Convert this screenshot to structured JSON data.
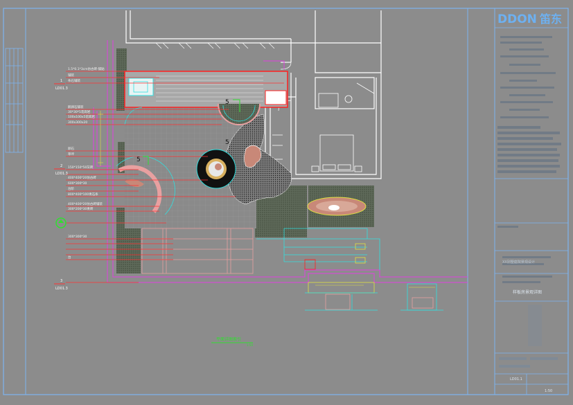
{
  "logo": {
    "text": "DDON",
    "suffix": "笛东",
    "color": "#5aa0e6"
  },
  "colors": {
    "background": "#8c8c8c",
    "frame": "#7db4f0",
    "walls": "#ffffff",
    "magenta": "#e040e0",
    "cyan": "#30e0e0",
    "red": "#ff2020",
    "green": "#20d020",
    "yellow": "#e0e040"
  },
  "annotations": {
    "tag_1": "LD01.3",
    "tag_2": "LD01.3",
    "tag_3": "LD01.3",
    "marker_1": "1",
    "marker_2": "2",
    "marker_3": "3",
    "elev_1": "5",
    "elev_2": "5",
    "elev_3": "5",
    "bottom_title": "平面详图索引",
    "bottom_subtitle": "1:50"
  },
  "leader_labels": [
    "1.5*0.1*3cm仿古砖-铺贴",
    "铺装",
    "条石铺装",
    "鹅卵石铺装",
    "30*30*5花岗岩",
    "100x100x5花岗岩",
    "300x300x20",
    "卵石",
    "草坪",
    "150*150*50灰砖",
    "400*400*20仿古砖",
    "600*300*30",
    "台阶",
    "800*400*100青石条",
    "400*400*20仿古砖铺装",
    "300*200*30青砖",
    "300*300*30",
    "台"
  ],
  "title_block": {
    "project_lines": [
      "XX别墅庭院景观设计",
      "景观施工图",
      "景观设计"
    ],
    "sheet_title": "样板房景观详图",
    "sheet_no": "LD01.1",
    "scale": "1:50"
  }
}
